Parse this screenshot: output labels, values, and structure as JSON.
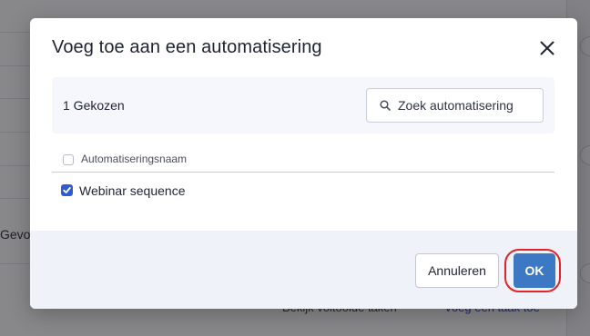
{
  "background": {
    "left_text": "Gevoer",
    "link_completed_tasks": "Bekijk voltooide taken",
    "link_add_task": "Voeg een taak toe"
  },
  "modal": {
    "title": "Voeg toe aan een automatisering",
    "close_icon": "close-icon",
    "selected_count": "1 Gekozen",
    "search": {
      "placeholder": "Zoek automatisering",
      "value": ""
    },
    "table": {
      "header": "Automatiseringsnaam",
      "header_checked": false,
      "rows": [
        {
          "name": "Webinar sequence",
          "checked": true
        }
      ]
    },
    "footer": {
      "cancel_label": "Annuleren",
      "ok_label": "OK"
    }
  },
  "colors": {
    "accent": "#3c78c4",
    "checkbox": "#2f5bd3",
    "highlight_ring": "#e0242a"
  }
}
